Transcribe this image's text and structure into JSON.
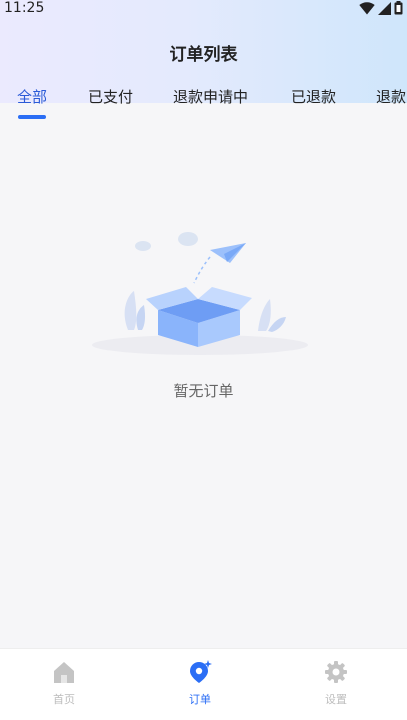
{
  "status": {
    "time": "11:25"
  },
  "header": {
    "title": "订单列表"
  },
  "tabs": [
    {
      "label": "全部",
      "active": true
    },
    {
      "label": "已支付",
      "active": false
    },
    {
      "label": "退款申请中",
      "active": false
    },
    {
      "label": "已退款",
      "active": false
    },
    {
      "label": "退款",
      "active": false
    }
  ],
  "empty": {
    "message": "暂无订单"
  },
  "bottom_nav": [
    {
      "label": "首页",
      "icon": "home-icon",
      "active": false
    },
    {
      "label": "订单",
      "icon": "order-icon",
      "active": true
    },
    {
      "label": "设置",
      "icon": "gear-icon",
      "active": false
    }
  ],
  "colors": {
    "accent": "#2b6ef5",
    "active_tab_text": "#2b5bd7",
    "inactive_nav": "#bdbdbd"
  }
}
